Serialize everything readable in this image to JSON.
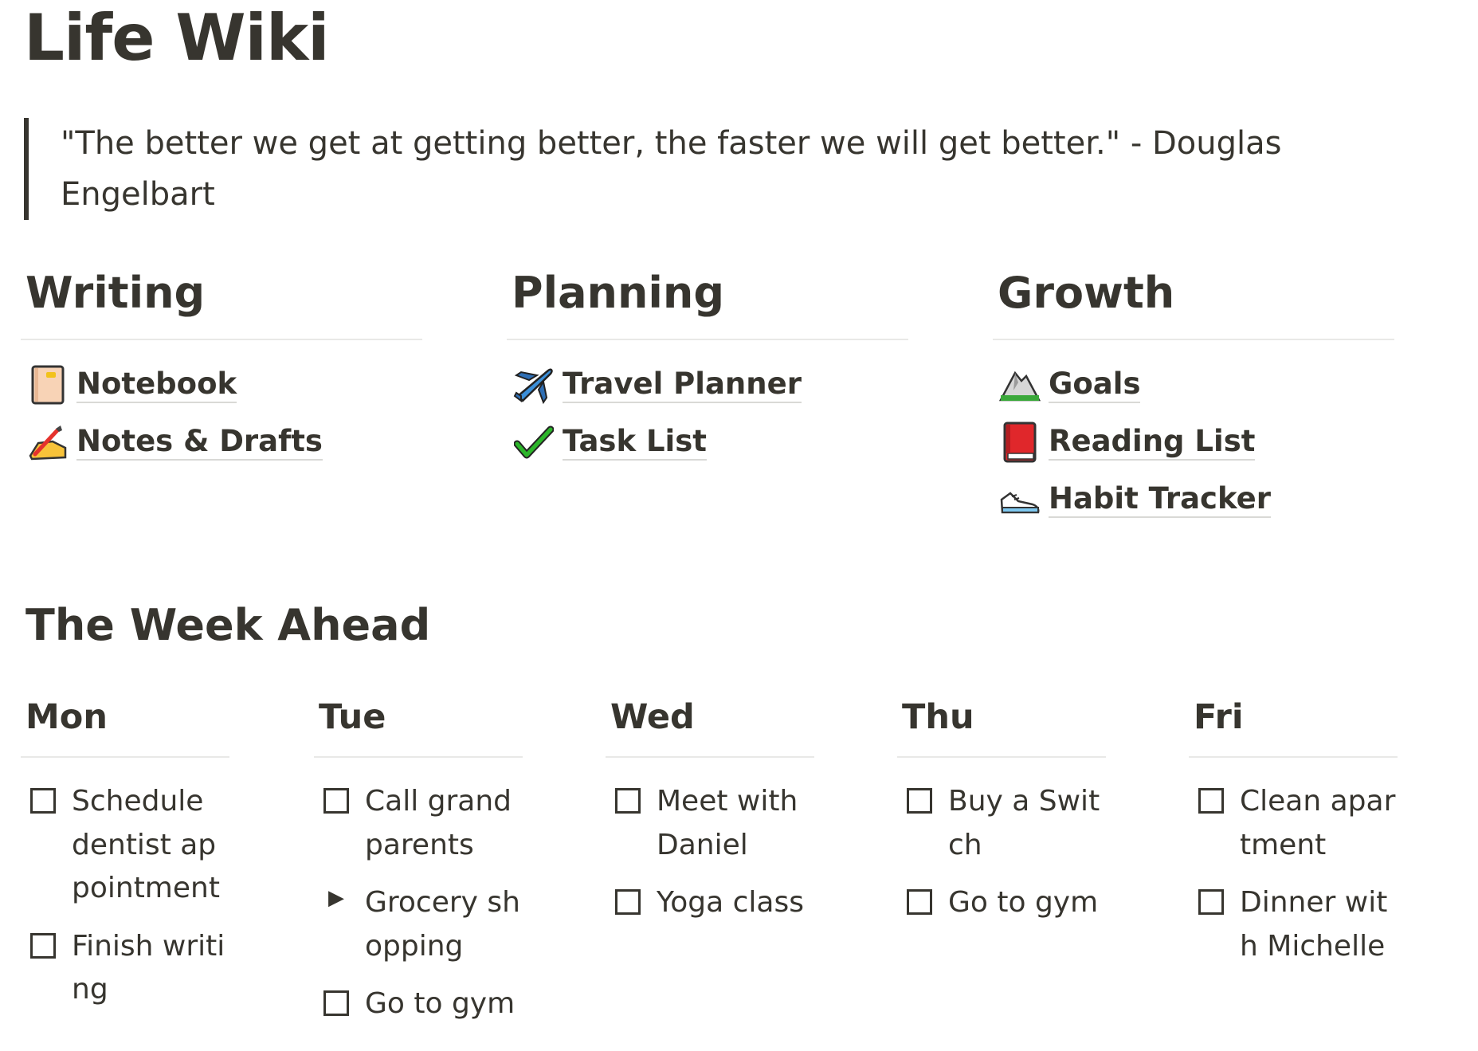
{
  "page": {
    "title": "Life Wiki",
    "quote": "\"The better we get at getting better, the faster we will get better.\" - Douglas Engelbart"
  },
  "columns": [
    {
      "heading": "Writing",
      "items": [
        {
          "icon": "notebook-icon",
          "label": "Notebook"
        },
        {
          "icon": "writing-hand-icon",
          "label": "Notes & Drafts"
        }
      ]
    },
    {
      "heading": "Planning",
      "items": [
        {
          "icon": "airplane-icon",
          "label": "Travel Planner"
        },
        {
          "icon": "checkmark-icon",
          "label": "Task List"
        }
      ]
    },
    {
      "heading": "Growth",
      "items": [
        {
          "icon": "mountain-icon",
          "label": "Goals"
        },
        {
          "icon": "red-book-icon",
          "label": "Reading List"
        },
        {
          "icon": "sneaker-icon",
          "label": "Habit Tracker"
        }
      ]
    }
  ],
  "week": {
    "title": "The Week Ahead",
    "days": [
      {
        "name": "Mon",
        "items": [
          {
            "type": "todo",
            "text": "Schedule dentist appointment"
          },
          {
            "type": "todo",
            "text": "Finish writing"
          }
        ]
      },
      {
        "name": "Tue",
        "items": [
          {
            "type": "todo",
            "text": "Call grandparents"
          },
          {
            "type": "toggle",
            "text": "Grocery shopping"
          },
          {
            "type": "todo",
            "text": "Go to gym"
          }
        ]
      },
      {
        "name": "Wed",
        "items": [
          {
            "type": "todo",
            "text": "Meet with Daniel"
          },
          {
            "type": "todo",
            "text": "Yoga class"
          }
        ]
      },
      {
        "name": "Thu",
        "items": [
          {
            "type": "todo",
            "text": "Buy a Switch"
          },
          {
            "type": "todo",
            "text": "Go to gym"
          }
        ]
      },
      {
        "name": "Fri",
        "items": [
          {
            "type": "todo",
            "text": "Clean apartment"
          },
          {
            "type": "todo",
            "text": "Dinner with Michelle"
          }
        ]
      }
    ]
  }
}
